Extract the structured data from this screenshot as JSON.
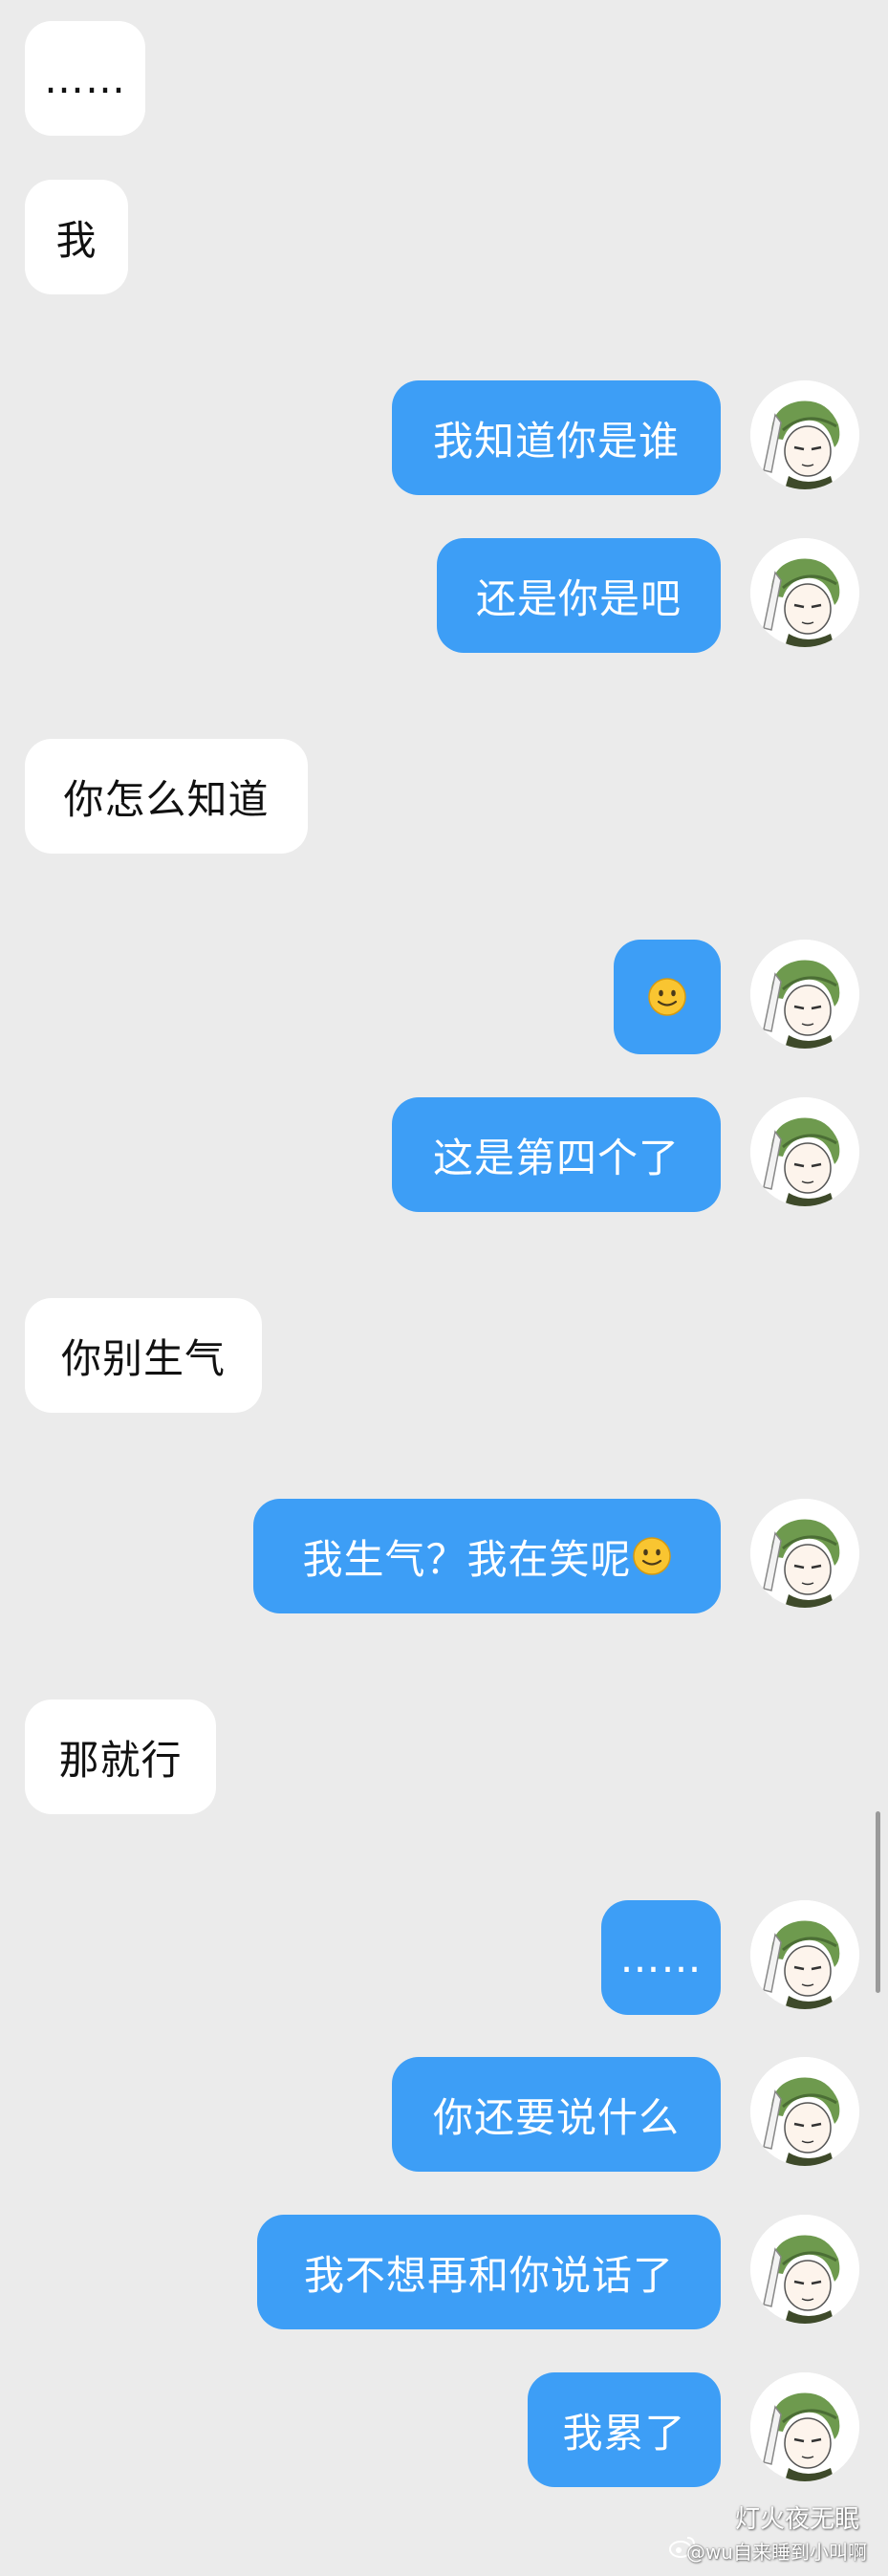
{
  "messages": [
    {
      "side": "incoming",
      "text": "……"
    },
    {
      "side": "incoming",
      "text": "我"
    },
    {
      "side": "outgoing",
      "text": "我知道你是谁"
    },
    {
      "side": "outgoing",
      "text": "还是你是吧"
    },
    {
      "side": "incoming",
      "text": "你怎么知道"
    },
    {
      "side": "outgoing",
      "text": "",
      "emoji": "smile-emoji"
    },
    {
      "side": "outgoing",
      "text": "这是第四个了"
    },
    {
      "side": "incoming",
      "text": "你别生气"
    },
    {
      "side": "outgoing",
      "text": "我生气？我在笑呢",
      "emoji": "smile-emoji"
    },
    {
      "side": "incoming",
      "text": "那就行"
    },
    {
      "side": "outgoing",
      "text": "……"
    },
    {
      "side": "outgoing",
      "text": "你还要说什么"
    },
    {
      "side": "outgoing",
      "text": "我不想再和你说话了"
    },
    {
      "side": "outgoing",
      "text": "我累了"
    }
  ],
  "watermark": {
    "line1": "灯火夜无眠",
    "line2": "@wu自来睡到小叫啊"
  },
  "colors": {
    "background": "#ebebeb",
    "incoming_bubble": "#ffffff",
    "outgoing_bubble": "#3d9ef6",
    "outgoing_text": "#ffffff"
  },
  "icons": {
    "avatar": "anime-character-avatar",
    "emoji": "smile-emoji",
    "watermark": "weibo-icon"
  }
}
